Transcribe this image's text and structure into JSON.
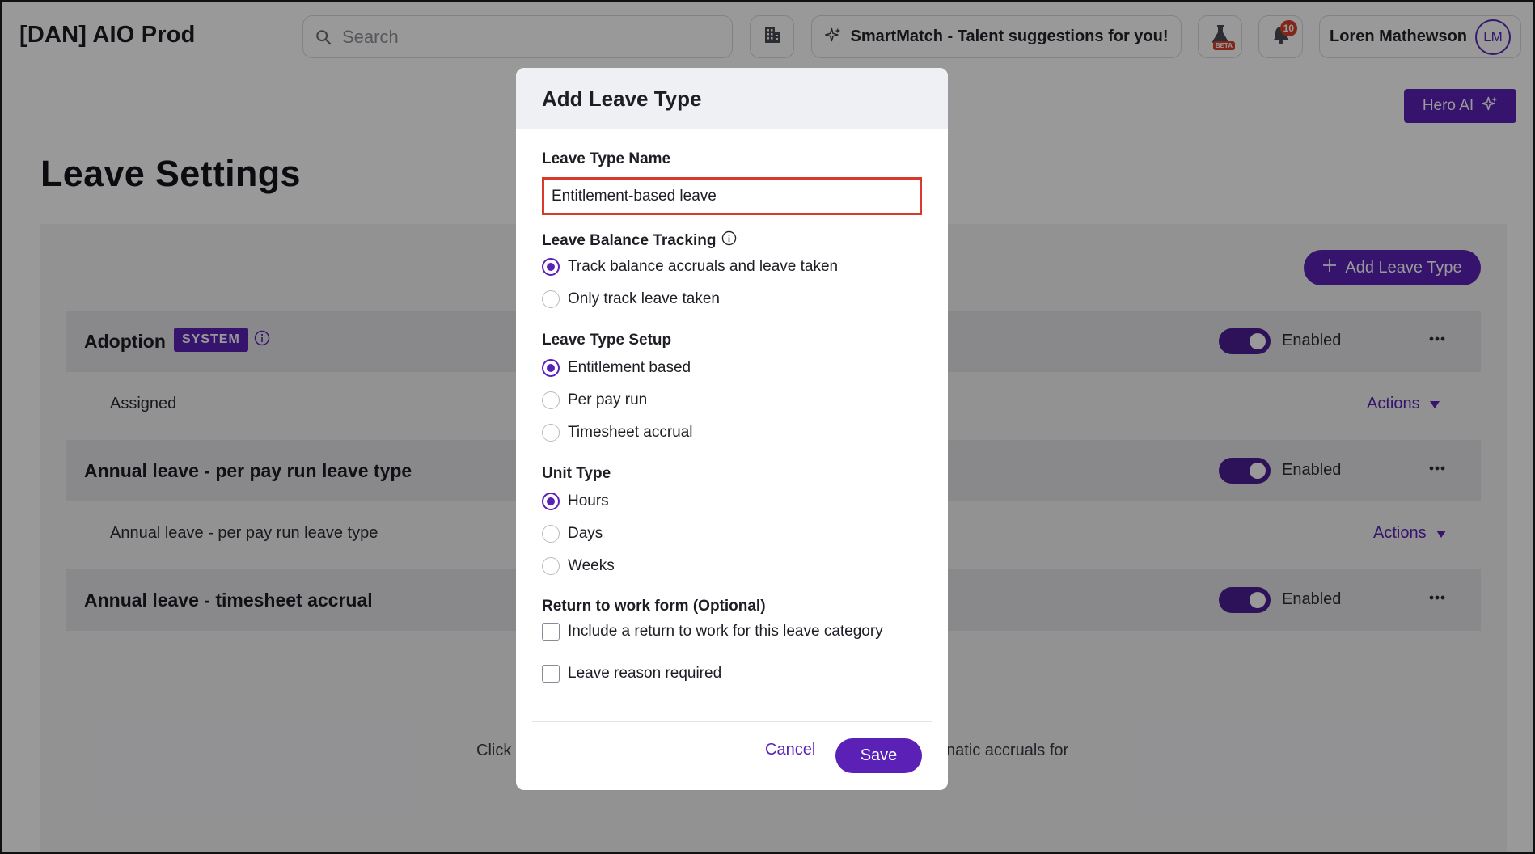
{
  "app": {
    "title": "[DAN] AIO Prod"
  },
  "search": {
    "placeholder": "Search",
    "icon": "search-icon"
  },
  "header": {
    "smartmatch_label": "SmartMatch - Talent suggestions for you!",
    "beta_tag": "BETA",
    "notification_count": "10",
    "user_name": "Loren Mathewson",
    "user_initials": "LM"
  },
  "page": {
    "hero_ai_label": "Hero AI",
    "title": "Leave Settings",
    "add_leave_type_label": "Add Leave Type",
    "leave_types": [
      {
        "title": "Adoption",
        "badge": "SYSTEM",
        "status": "Enabled",
        "sub_label": "Assigned",
        "actions_label": "Actions"
      },
      {
        "title": "Annual leave - per pay run leave type",
        "status": "Enabled",
        "sub_label": "Annual leave - per pay run leave type",
        "actions_label": "Actions"
      },
      {
        "title": "Annual leave - timesheet accrual",
        "status": "Enabled"
      }
    ],
    "bottom_hint_left": "Click",
    "bottom_hint_right": "natic accruals for"
  },
  "modal": {
    "title": "Add Leave Type",
    "leave_type_name_label": "Leave Type Name",
    "leave_type_name_value": "Entitlement-based leave",
    "balance_tracking_label": "Leave Balance Tracking",
    "balance_options": [
      "Track balance accruals and leave taken",
      "Only track leave taken"
    ],
    "balance_selected": 0,
    "setup_label": "Leave Type Setup",
    "setup_options": [
      "Entitlement based",
      "Per pay run",
      "Timesheet accrual"
    ],
    "setup_selected": 0,
    "unit_label": "Unit Type",
    "unit_options": [
      "Hours",
      "Days",
      "Weeks"
    ],
    "unit_selected": 0,
    "return_form_label": "Return to work form (Optional)",
    "return_checkbox_label": "Include a return to work for this leave category",
    "return_checked": false,
    "reason_checkbox_label": "Leave reason required",
    "reason_checked": false,
    "cancel_label": "Cancel",
    "save_label": "Save"
  },
  "colors": {
    "accent": "#5b21b6",
    "highlight_border": "#d93a2b",
    "notification": "#d6412b"
  }
}
